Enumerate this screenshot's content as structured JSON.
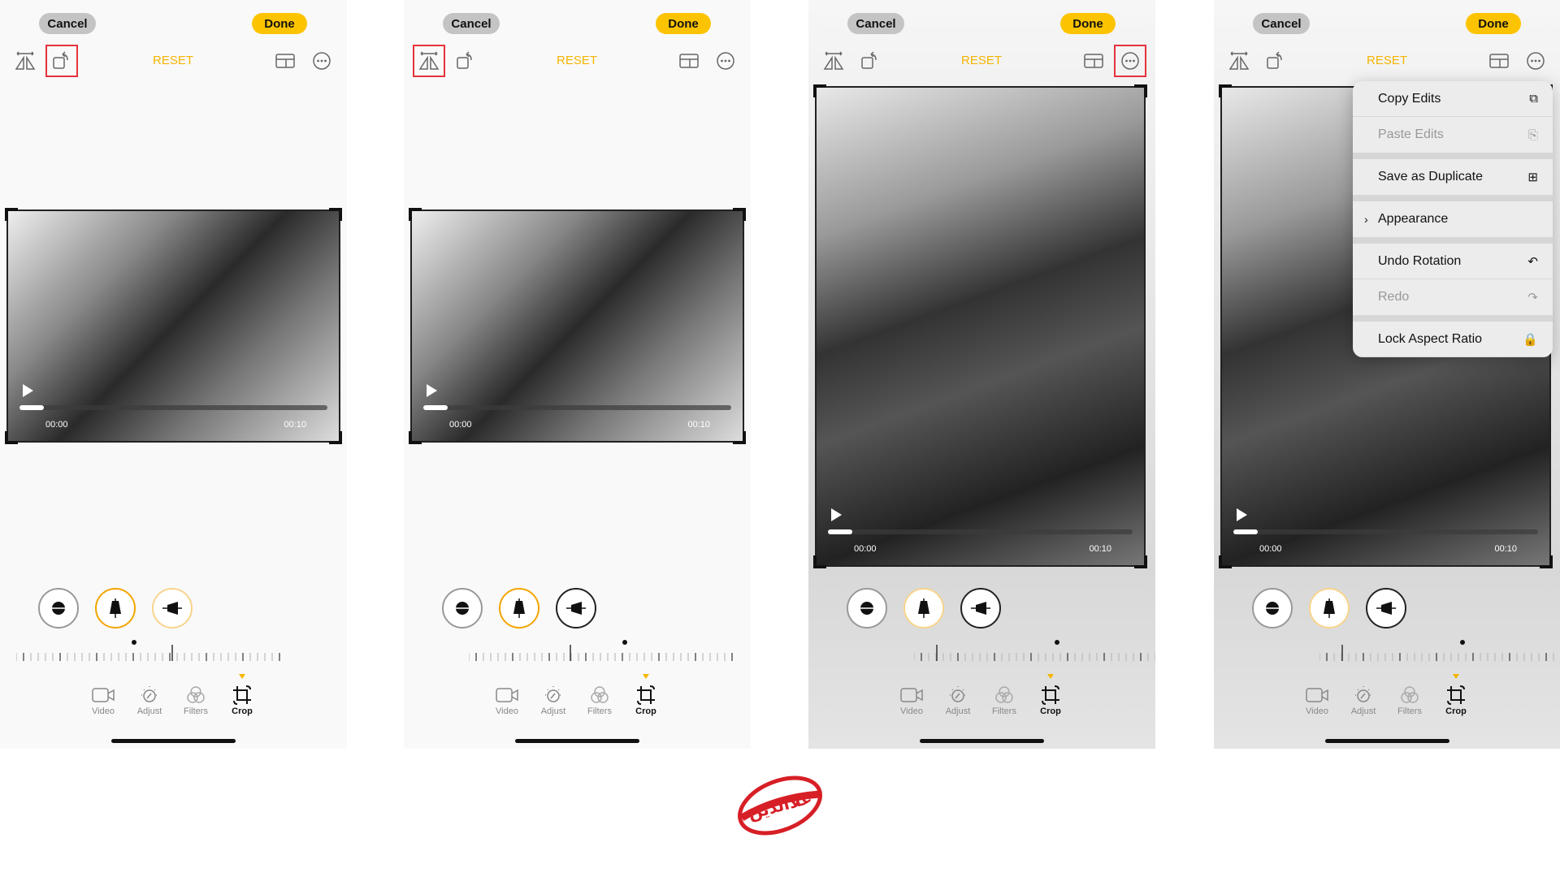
{
  "common": {
    "cancel": "Cancel",
    "done": "Done",
    "reset": "RESET",
    "time_start": "00:00",
    "time_end": "00:10",
    "tabs": [
      {
        "label": "Video",
        "icon": "video-camera-icon"
      },
      {
        "label": "Adjust",
        "icon": "adjust-dial-icon"
      },
      {
        "label": "Filters",
        "icon": "filters-icon"
      },
      {
        "label": "Crop",
        "icon": "crop-rotate-icon"
      }
    ],
    "selected_tab": "Crop"
  },
  "panels": [
    {
      "highlight": "rotate",
      "orientation": "rotated-landscape",
      "playback_progress": 0.08
    },
    {
      "highlight": "flip",
      "orientation": "rotated-landscape-flipped",
      "playback_progress": 0.08
    },
    {
      "highlight": "more",
      "orientation": "portrait",
      "playback_progress": 0.08
    },
    {
      "highlight": "none",
      "orientation": "portrait",
      "playback_progress": 0.08,
      "menu_open": true
    }
  ],
  "menu": {
    "items": [
      {
        "label": "Copy Edits",
        "icon": "copy-edits-icon",
        "enabled": true
      },
      {
        "label": "Paste Edits",
        "icon": "paste-edits-icon",
        "enabled": false,
        "sep_after": true
      },
      {
        "label": "Save as Duplicate",
        "icon": "duplicate-icon",
        "enabled": true,
        "sep_after": true
      },
      {
        "label": "Appearance",
        "icon": "chevron-right-icon",
        "enabled": true,
        "submenu": true,
        "sep_after": true
      },
      {
        "label": "Undo Rotation",
        "icon": "undo-icon",
        "enabled": true
      },
      {
        "label": "Redo",
        "icon": "redo-icon",
        "enabled": false,
        "sep_after": true
      },
      {
        "label": "Lock Aspect Ratio",
        "icon": "lock-icon",
        "enabled": true
      }
    ]
  },
  "logo": {
    "text": "علاالدین",
    "color": "#d71f26"
  },
  "colors": {
    "accent": "#fcc400",
    "highlight": "#e5333d"
  }
}
